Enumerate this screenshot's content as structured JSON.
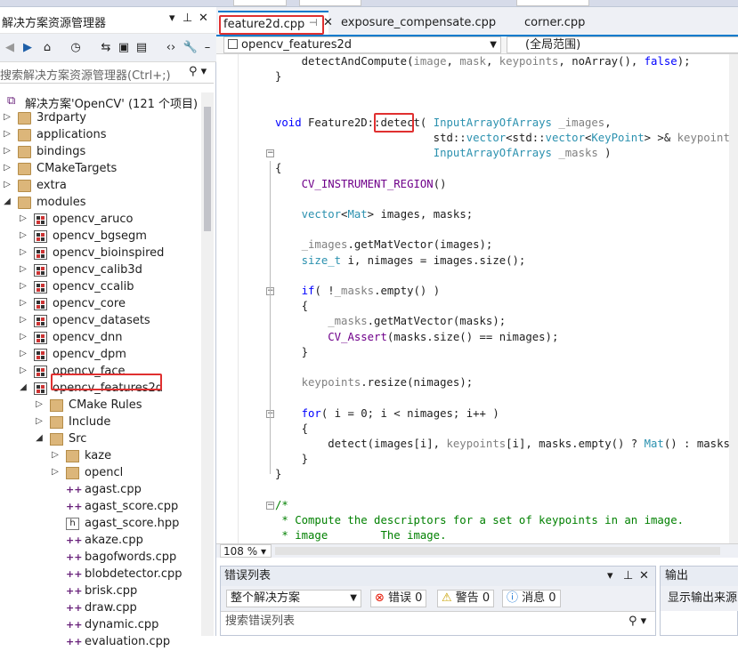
{
  "solution_explorer": {
    "title": "解决方案资源管理器",
    "search_placeholder": "搜索解决方案资源管理器(Ctrl+;)",
    "tree": [
      {
        "label": "解决方案'OpenCV' (121 个项目)",
        "icon": "solution-icon"
      },
      {
        "label": "3rdparty",
        "icon": "folder-icon"
      },
      {
        "label": "applications",
        "icon": "folder-icon"
      },
      {
        "label": "bindings",
        "icon": "folder-icon"
      },
      {
        "label": "CMakeTargets",
        "icon": "folder-icon"
      },
      {
        "label": "extra",
        "icon": "folder-icon"
      },
      {
        "label": "modules",
        "icon": "folder-icon"
      },
      {
        "label": "opencv_aruco",
        "icon": "project-icon"
      },
      {
        "label": "opencv_bgsegm",
        "icon": "project-icon"
      },
      {
        "label": "opencv_bioinspired",
        "icon": "project-icon"
      },
      {
        "label": "opencv_calib3d",
        "icon": "project-icon"
      },
      {
        "label": "opencv_ccalib",
        "icon": "project-icon"
      },
      {
        "label": "opencv_core",
        "icon": "project-icon"
      },
      {
        "label": "opencv_datasets",
        "icon": "project-icon"
      },
      {
        "label": "opencv_dnn",
        "icon": "project-icon"
      },
      {
        "label": "opencv_dpm",
        "icon": "project-icon"
      },
      {
        "label": "opencv_face",
        "icon": "project-icon"
      },
      {
        "label": "opencv_features2d",
        "icon": "project-icon"
      },
      {
        "label": "CMake Rules",
        "icon": "filter-icon"
      },
      {
        "label": "Include",
        "icon": "filter-icon"
      },
      {
        "label": "Src",
        "icon": "filter-icon"
      },
      {
        "label": "kaze",
        "icon": "filter-icon"
      },
      {
        "label": "opencl",
        "icon": "filter-icon"
      },
      {
        "label": "agast.cpp",
        "icon": "cpp-file-icon"
      },
      {
        "label": "agast_score.cpp",
        "icon": "cpp-file-icon"
      },
      {
        "label": "agast_score.hpp",
        "icon": "header-file-icon"
      },
      {
        "label": "akaze.cpp",
        "icon": "cpp-file-icon"
      },
      {
        "label": "bagofwords.cpp",
        "icon": "cpp-file-icon"
      },
      {
        "label": "blobdetector.cpp",
        "icon": "cpp-file-icon"
      },
      {
        "label": "brisk.cpp",
        "icon": "cpp-file-icon"
      },
      {
        "label": "draw.cpp",
        "icon": "cpp-file-icon"
      },
      {
        "label": "dynamic.cpp",
        "icon": "cpp-file-icon"
      },
      {
        "label": "evaluation.cpp",
        "icon": "cpp-file-icon"
      }
    ]
  },
  "tabs": [
    {
      "label": "feature2d.cpp"
    },
    {
      "label": "exposure_compensate.cpp"
    },
    {
      "label": "corner.cpp"
    }
  ],
  "navbar": {
    "project": "opencv_features2d",
    "scope": "(全局范围)"
  },
  "editor": {
    "zoom": "108 %",
    "lines": [
      "    detectAndCompute(image, mask, keypoints, noArray(), false);",
      "}",
      "",
      "",
      "void Feature2D::detect( InputArrayOfArrays _images,",
      "                        std::vector<std::vector<KeyPoint> >& keypoints,",
      "                        InputArrayOfArrays _masks )",
      "{",
      "    CV_INSTRUMENT_REGION()",
      "",
      "    vector<Mat> images, masks;",
      "",
      "    _images.getMatVector(images);",
      "    size_t i, nimages = images.size();",
      "",
      "    if( !_masks.empty() )",
      "    {",
      "        _masks.getMatVector(masks);",
      "        CV_Assert(masks.size() == nimages);",
      "    }",
      "",
      "    keypoints.resize(nimages);",
      "",
      "    for( i = 0; i < nimages; i++ )",
      "    {",
      "        detect(images[i], keypoints[i], masks.empty() ? Mat() : masks[i] );",
      "    }",
      "}",
      "",
      "/*",
      " * Compute the descriptors for a set of keypoints in an image.",
      " * image        The image."
    ]
  },
  "error_list": {
    "title": "错误列表",
    "scope": "整个解决方案",
    "errors": "错误 0",
    "warnings": "警告 0",
    "messages": "消息 0",
    "search_placeholder": "搜索错误列表"
  },
  "output": {
    "title": "输出",
    "source_label": "显示输出来源(S"
  },
  "colors": {
    "accent": "#007acc",
    "highlight_box": "#e03030"
  }
}
